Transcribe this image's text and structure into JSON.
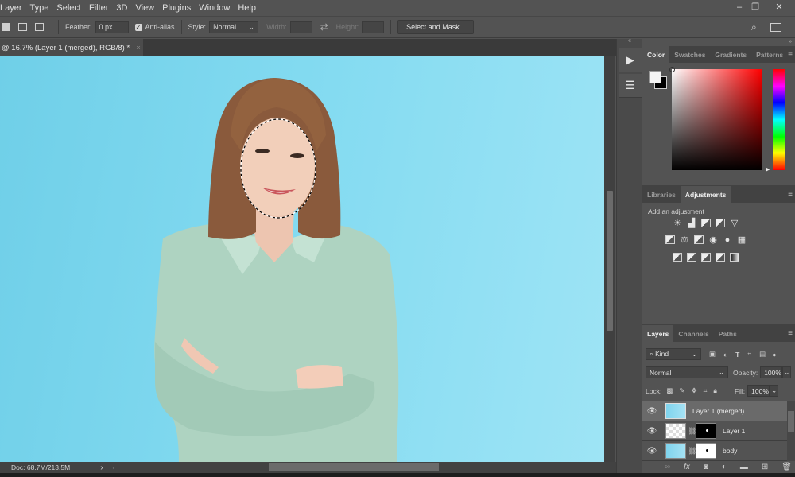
{
  "menu": [
    "Layer",
    "Type",
    "Select",
    "Filter",
    "3D",
    "View",
    "Plugins",
    "Window",
    "Help"
  ],
  "window_controls": {
    "minimize": "–",
    "restore": "❐",
    "close": "✕"
  },
  "options": {
    "feather_label": "Feather:",
    "feather_value": "0 px",
    "antialias_label": "Anti-alias",
    "antialias_checked": true,
    "style_label": "Style:",
    "style_value": "Normal",
    "width_label": "Width:",
    "height_label": "Height:",
    "select_mask_label": "Select and Mask...",
    "swap_icon": "⇄"
  },
  "document": {
    "tab_title": "@ 16.7% (Layer 1 (merged), RGB/8) *",
    "close_glyph": "×",
    "status": "Doc: 68.7M/213.5M",
    "status_arrow": "›",
    "scroll_left": "‹"
  },
  "colors": {
    "foreground": "#f4f4f4",
    "background": "#000000",
    "canvas_bg": "#84dbf1",
    "ui_bg": "#535353"
  },
  "color_panel": {
    "tabs": [
      "Color",
      "Swatches",
      "Gradients",
      "Patterns"
    ],
    "active": "Color"
  },
  "adjustments_panel": {
    "tabs": [
      "Libraries",
      "Adjustments"
    ],
    "active": "Adjustments",
    "hint": "Add an adjustment",
    "rows": [
      [
        "brightness-contrast",
        "levels",
        "curves",
        "exposure",
        "vibrance"
      ],
      [
        "hue-saturation",
        "color-balance",
        "black-white",
        "photo-filter",
        "channel-mixer",
        "color-lookup"
      ],
      [
        "invert",
        "posterize",
        "threshold",
        "selective-color",
        "gradient-map"
      ]
    ]
  },
  "layers_panel": {
    "tabs": [
      "Layers",
      "Channels",
      "Paths"
    ],
    "active": "Layers",
    "filter_label": "Kind",
    "blend_mode": "Normal",
    "opacity_label": "Opacity:",
    "opacity_value": "100%",
    "lock_label": "Lock:",
    "fill_label": "Fill:",
    "fill_value": "100%",
    "layers": [
      {
        "name": "Layer 1 (merged)",
        "visible": true,
        "selected": true,
        "has_mask": false
      },
      {
        "name": "Layer 1",
        "visible": true,
        "selected": false,
        "has_mask": true,
        "mask": "black"
      },
      {
        "name": "body",
        "visible": true,
        "selected": false,
        "has_mask": true,
        "mask": "white"
      }
    ],
    "footer_icons": [
      "link-layers",
      "fx",
      "add-mask",
      "new-adjustment",
      "new-group",
      "new-layer",
      "delete-layer"
    ]
  }
}
